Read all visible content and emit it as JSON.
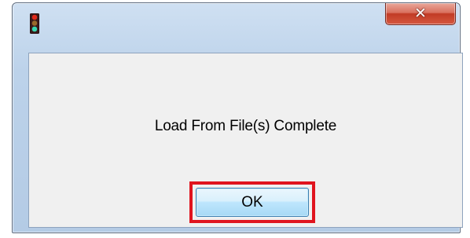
{
  "window": {
    "app_icon": "traffic-light-icon",
    "close_icon": "close-icon",
    "close_symbol": "✕"
  },
  "dialog": {
    "message": "Load From File(s) Complete",
    "ok_label": "OK"
  },
  "colors": {
    "highlight": "#e0141e",
    "close_button": "#c13b25",
    "ok_button": "#bee6fd",
    "client_background": "#f0f0f0"
  }
}
